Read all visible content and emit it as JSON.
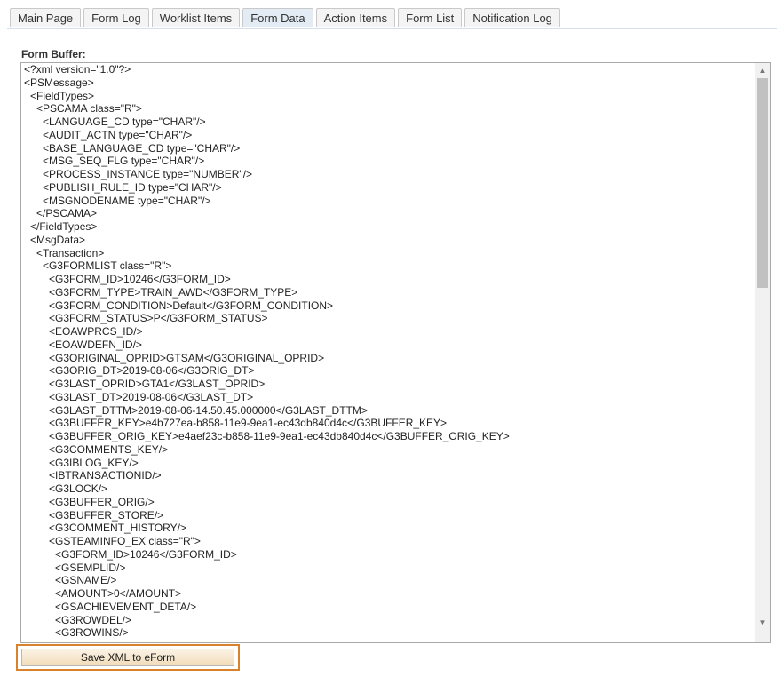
{
  "tabs": [
    {
      "label": "Main Page"
    },
    {
      "label": "Form Log"
    },
    {
      "label": "Worklist Items"
    },
    {
      "label": "Form Data",
      "active": true
    },
    {
      "label": "Action Items"
    },
    {
      "label": "Form List"
    },
    {
      "label": "Notification Log"
    }
  ],
  "form_buffer": {
    "label": "Form Buffer:",
    "lines": [
      {
        "i": 0,
        "t": "<?xml version=\"1.0\"?>"
      },
      {
        "i": 0,
        "t": "<PSMessage>"
      },
      {
        "i": 1,
        "t": "<FieldTypes>"
      },
      {
        "i": 2,
        "t": "<PSCAMA class=\"R\">"
      },
      {
        "i": 3,
        "t": "<LANGUAGE_CD type=\"CHAR\"/>"
      },
      {
        "i": 3,
        "t": "<AUDIT_ACTN type=\"CHAR\"/>"
      },
      {
        "i": 3,
        "t": "<BASE_LANGUAGE_CD type=\"CHAR\"/>"
      },
      {
        "i": 3,
        "t": "<MSG_SEQ_FLG type=\"CHAR\"/>"
      },
      {
        "i": 3,
        "t": "<PROCESS_INSTANCE type=\"NUMBER\"/>"
      },
      {
        "i": 3,
        "t": "<PUBLISH_RULE_ID type=\"CHAR\"/>"
      },
      {
        "i": 3,
        "t": "<MSGNODENAME type=\"CHAR\"/>"
      },
      {
        "i": 2,
        "t": "</PSCAMA>"
      },
      {
        "i": 1,
        "t": "</FieldTypes>"
      },
      {
        "i": 1,
        "t": "<MsgData>"
      },
      {
        "i": 2,
        "t": "<Transaction>"
      },
      {
        "i": 3,
        "t": "<G3FORMLIST class=\"R\">"
      },
      {
        "i": 4,
        "t": "<G3FORM_ID>10246</G3FORM_ID>"
      },
      {
        "i": 4,
        "t": "<G3FORM_TYPE>TRAIN_AWD</G3FORM_TYPE>"
      },
      {
        "i": 4,
        "t": "<G3FORM_CONDITION>Default</G3FORM_CONDITION>"
      },
      {
        "i": 4,
        "t": "<G3FORM_STATUS>P</G3FORM_STATUS>"
      },
      {
        "i": 4,
        "t": "<EOAWPRCS_ID/>"
      },
      {
        "i": 4,
        "t": "<EOAWDEFN_ID/>"
      },
      {
        "i": 4,
        "t": "<G3ORIGINAL_OPRID>GTSAM</G3ORIGINAL_OPRID>"
      },
      {
        "i": 4,
        "t": "<G3ORIG_DT>2019-08-06</G3ORIG_DT>"
      },
      {
        "i": 4,
        "t": "<G3LAST_OPRID>GTA1</G3LAST_OPRID>"
      },
      {
        "i": 4,
        "t": "<G3LAST_DT>2019-08-06</G3LAST_DT>"
      },
      {
        "i": 4,
        "t": "<G3LAST_DTTM>2019-08-06-14.50.45.000000</G3LAST_DTTM>"
      },
      {
        "i": 4,
        "t": "<G3BUFFER_KEY>e4b727ea-b858-11e9-9ea1-ec43db840d4c</G3BUFFER_KEY>"
      },
      {
        "i": 4,
        "t": "<G3BUFFER_ORIG_KEY>e4aef23c-b858-11e9-9ea1-ec43db840d4c</G3BUFFER_ORIG_KEY>"
      },
      {
        "i": 4,
        "t": "<G3COMMENTS_KEY/>"
      },
      {
        "i": 4,
        "t": "<G3IBLOG_KEY/>"
      },
      {
        "i": 4,
        "t": "<IBTRANSACTIONID/>"
      },
      {
        "i": 4,
        "t": "<G3LOCK/>"
      },
      {
        "i": 4,
        "t": "<G3BUFFER_ORIG/>"
      },
      {
        "i": 4,
        "t": "<G3BUFFER_STORE/>"
      },
      {
        "i": 4,
        "t": "<G3COMMENT_HISTORY/>"
      },
      {
        "i": 4,
        "t": "<GSTEAMINFO_EX class=\"R\">"
      },
      {
        "i": 5,
        "t": "<G3FORM_ID>10246</G3FORM_ID>"
      },
      {
        "i": 5,
        "t": "<GSEMPLID/>"
      },
      {
        "i": 5,
        "t": "<GSNAME/>"
      },
      {
        "i": 5,
        "t": "<AMOUNT>0</AMOUNT>"
      },
      {
        "i": 5,
        "t": "<GSACHIEVEMENT_DETA/>"
      },
      {
        "i": 5,
        "t": "<G3ROWDEL/>"
      },
      {
        "i": 5,
        "t": "<G3ROWINS/>"
      }
    ]
  },
  "save_button": {
    "label": "Save XML to eForm"
  },
  "colors": {
    "highlight_border": "#d9822b"
  }
}
